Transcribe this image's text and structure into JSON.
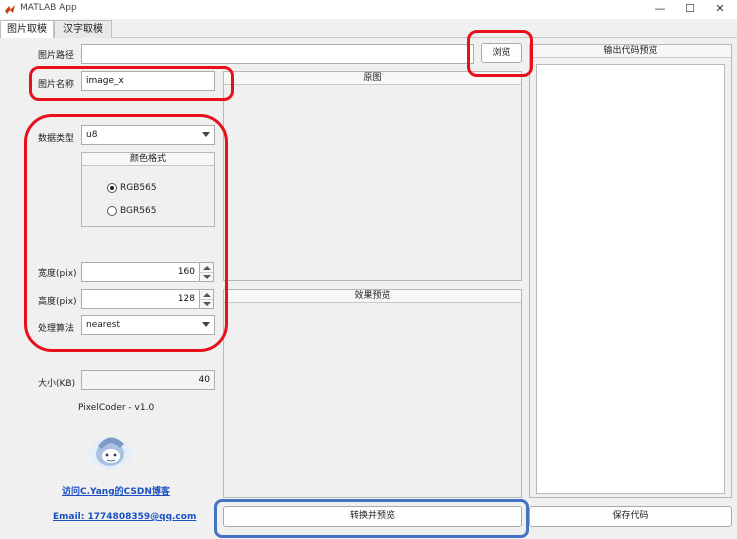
{
  "window": {
    "title": "MATLAB App",
    "minimize": "—",
    "maximize": "☐",
    "close": "✕"
  },
  "tabs": [
    {
      "label": "图片取模",
      "active": true
    },
    {
      "label": "汉字取模",
      "active": false
    }
  ],
  "form": {
    "path_label": "图片路径",
    "path_value": "",
    "browse_label": "浏览",
    "name_label": "图片名称",
    "name_value": "image_x",
    "datatype_label": "数据类型",
    "datatype_value": "u8",
    "color_format": {
      "title": "颜色格式",
      "options": [
        {
          "label": "RGB565",
          "selected": true
        },
        {
          "label": "BGR565",
          "selected": false
        }
      ]
    },
    "width_label": "宽度(pix)",
    "width_value": "160",
    "height_label": "高度(pix)",
    "height_value": "128",
    "algo_label": "处理算法",
    "algo_value": "nearest",
    "size_label": "大小(KB)",
    "size_value": "40"
  },
  "info": {
    "version": "PixelCoder - v1.0",
    "visit_link": "访问C.Yang的CSDN博客",
    "email_link": "Email: 1774808359@qq.com"
  },
  "panels": {
    "original_title": "原图",
    "preview_title": "效果预览",
    "code_title": "输出代码预览"
  },
  "actions": {
    "convert_label": "转换并预览",
    "save_label": "保存代码"
  },
  "colors": {
    "highlight_red": "#e8101a",
    "highlight_blue": "#4472c4",
    "link": "#1a4fc4"
  }
}
